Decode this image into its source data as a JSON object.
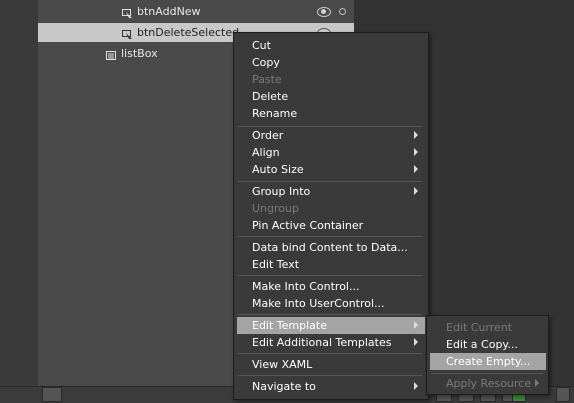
{
  "tree": {
    "items": [
      {
        "label": "btnAddNew"
      },
      {
        "label": "btnDeleteSelected"
      },
      {
        "label": "listBox"
      }
    ]
  },
  "context_menu": {
    "items": [
      {
        "label": "Cut",
        "enabled": true
      },
      {
        "label": "Copy",
        "enabled": true
      },
      {
        "label": "Paste",
        "enabled": false
      },
      {
        "label": "Delete",
        "enabled": true
      },
      {
        "label": "Rename",
        "enabled": true
      },
      {
        "label": "Order",
        "enabled": true,
        "submenu": true
      },
      {
        "label": "Align",
        "enabled": true,
        "submenu": true
      },
      {
        "label": "Auto Size",
        "enabled": true,
        "submenu": true
      },
      {
        "label": "Group Into",
        "enabled": true,
        "submenu": true
      },
      {
        "label": "Ungroup",
        "enabled": false
      },
      {
        "label": "Pin Active Container",
        "enabled": true
      },
      {
        "label": "Data bind Content to Data...",
        "enabled": true
      },
      {
        "label": "Edit Text",
        "enabled": true
      },
      {
        "label": "Make Into Control...",
        "enabled": true
      },
      {
        "label": "Make Into UserControl...",
        "enabled": true
      },
      {
        "label": "Edit Template",
        "enabled": true,
        "submenu": true,
        "highlighted": true
      },
      {
        "label": "Edit Additional Templates",
        "enabled": true,
        "submenu": true
      },
      {
        "label": "View XAML",
        "enabled": true
      },
      {
        "label": "Navigate to",
        "enabled": true,
        "submenu": true
      }
    ]
  },
  "submenu": {
    "items": [
      {
        "label": "Edit Current",
        "enabled": false
      },
      {
        "label": "Edit a Copy...",
        "enabled": true
      },
      {
        "label": "Create Empty...",
        "enabled": true,
        "highlighted": true
      },
      {
        "label": "Apply Resource",
        "enabled": false,
        "submenu": true
      }
    ]
  },
  "colors": {
    "panel": "#4a4a4a",
    "background": "#333333",
    "menu": "#3a3a3a",
    "highlight": "#a4a4a4",
    "selection": "#c8c8c8"
  }
}
